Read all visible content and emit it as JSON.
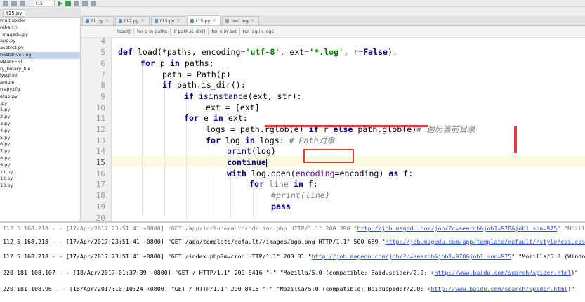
{
  "toolbar": {
    "run_config": "t15"
  },
  "top_file_tab": "t15.py",
  "project_tree": [
    "multispider",
    "rebarch",
    "_magedu.py",
    "app.py",
    "asetest.py",
    "hostdriver.log",
    "MANIFEST",
    "ry_binary_file",
    "iysql.ini",
    "ample",
    "rrapy.cfg",
    "etup.py",
    ".py",
    "1.py",
    "2.py",
    "3.py",
    "4.py",
    "5.py",
    "6.py",
    "7.py",
    "8.py",
    "9.py",
    "11.py",
    "12.py",
    "13.py"
  ],
  "selected_tree_index": 5,
  "tabs": [
    {
      "label": "t1.py",
      "icon": "python-file-icon"
    },
    {
      "label": "t12.py",
      "icon": "python-file-icon"
    },
    {
      "label": "t13.py",
      "icon": "python-file-icon"
    },
    {
      "label": "t15.py",
      "icon": "python-file-icon",
      "active": true
    },
    {
      "label": "test.log",
      "icon": "log-file-icon"
    }
  ],
  "breadcrumb": [
    "load()",
    "for p in paths",
    "if path.is_dir()",
    "for e in ext",
    "for log in logs"
  ],
  "line_numbers": [
    "4",
    "5",
    "6",
    "7",
    "8",
    "9",
    "10",
    "11",
    "12",
    "13",
    "14",
    "15",
    "16",
    "17",
    "18",
    "19",
    "20"
  ],
  "current_line": "15",
  "code": {
    "l5_def": "def",
    "l5_rest": " load(*paths, encoding=",
    "l5_str1": "'utf-8'",
    "l5_mid": ", ext=",
    "l5_str2": "'*.log'",
    "l5_mid2": ", r=",
    "l5_false": "False",
    "l5_end": "):",
    "l6_for": "for",
    "l6_p": " p ",
    "l6_in": "in",
    "l6_rest": " paths:",
    "l7": "path = Path(p)",
    "l8_if": "if",
    "l8_rest": " path.is_dir():",
    "l9_if": "if",
    "l9_isinst": " isinstance",
    "l9_rest": "(ext, str):",
    "l10": "ext = [ext]",
    "l11_for": "for",
    "l11_e": " e ",
    "l11_in": "in",
    "l11_rest": " ext:",
    "l12_a": "logs = path.rglob(e) ",
    "l12_if": "if",
    "l12_b": " r ",
    "l12_else": "else",
    "l12_c": " path.glob(e)",
    "l12_cmt": "# 遍历当前目录",
    "l13_for": "for",
    "l13_a": " log ",
    "l13_in": "in",
    "l13_b": " logs: ",
    "l13_cmt": "# Path对象",
    "l14_print": "print",
    "l14_rest": "(log)",
    "l15_continue": "continue",
    "l16_with": "with",
    "l16_a": " log.open(",
    "l16_kw": "encoding",
    "l16_b": "=encoding) ",
    "l16_as": "as",
    "l16_c": " f:",
    "l17_for": "for",
    "l17_line": " line ",
    "l17_in": "in",
    "l17_rest": " f:",
    "l18_cmt": "#print(line)",
    "l19_pass": "pass"
  },
  "log_lines": [
    {
      "pre": "112.5.168.218 - - [17/Apr/2017:23:51:41 +0800] \"GET /app/include/authcode.inc.php HTTP/1.1\" 200 390 \"",
      "link": "http://job.magedu.com/job/?c=search&job1=978&job1_son=975",
      "post": "\" \"Mozill"
    },
    {
      "pre": "112.5.168.218 - - [17/Apr/2017:23:51:41 +0800] \"GET /app/template/default//images/bgb.png HTTP/1.1\" 500 689 \"",
      "link": "http://job.magedu.com/app/template/default//style/css.css",
      "post": "\""
    },
    {
      "pre": "112.5.168.218 - - [17/Apr/2017:23:51:41 +0800] \"GET /index.php?m=cron HTTP/1.1\" 200 31 \"",
      "link": "http://job.magedu.com/job/?c=search&job1=978&job1_son=975",
      "post": "\" \"Mozilla/5.0 (Window"
    },
    {
      "pre": "220.181.108.107 - - [18/Apr/2017:01:37:39 +0800] \"GET / HTTP/1.1\" 200 8416 \"-\" \"Mozilla/5.0 (compatible; Baiduspider/2.0; +",
      "link": "http://www.baidu.com/search/spider.html",
      "post": ")\""
    },
    {
      "pre": "220.181.108.96 - - [18/Apr/2017:10:10:24 +0800] \"GET / HTTP/1.1\" 200 8416 \"-\" \"Mozilla/5.0 (compatible; Baiduspider/2.0; +",
      "link": "http://www.baidu.com/search/spider.html",
      "post": ")\""
    }
  ]
}
